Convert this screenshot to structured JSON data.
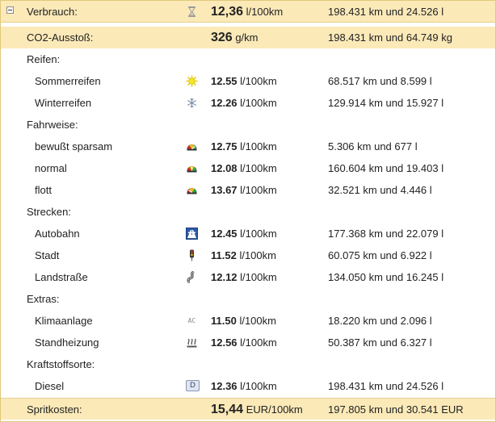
{
  "colors": {
    "highlight": "#fbe9b8",
    "border": "#e0c97a"
  },
  "summary": {
    "consumption": {
      "label": "Verbrauch:",
      "icon": "hourglass-icon",
      "value": "12,36",
      "unit": "l/100km",
      "detail": "198.431 km und 24.526 l"
    },
    "co2": {
      "label": "CO2-Ausstoß:",
      "value": "326",
      "unit": "g/km",
      "detail": "198.431 km und 64.749 kg"
    }
  },
  "groups": [
    {
      "label": "Reifen:",
      "items": [
        {
          "label": "Sommerreifen",
          "icon": "sun-icon",
          "value": "12.55",
          "unit": "l/100km",
          "detail": "68.517 km und 8.599 l"
        },
        {
          "label": "Winterreifen",
          "icon": "snowflake-icon",
          "value": "12.26",
          "unit": "l/100km",
          "detail": "129.914 km und 15.927 l"
        }
      ]
    },
    {
      "label": "Fahrweise:",
      "items": [
        {
          "label": "bewußt sparsam",
          "icon": "speedometer-green-icon",
          "value": "12.75",
          "unit": "l/100km",
          "detail": "5.306 km und 677 l"
        },
        {
          "label": "normal",
          "icon": "speedometer-yellow-icon",
          "value": "12.08",
          "unit": "l/100km",
          "detail": "160.604 km und 19.403 l"
        },
        {
          "label": "flott",
          "icon": "speedometer-red-icon",
          "value": "13.67",
          "unit": "l/100km",
          "detail": "32.521 km und 4.446 l"
        }
      ]
    },
    {
      "label": "Strecken:",
      "items": [
        {
          "label": "Autobahn",
          "icon": "autobahn-icon",
          "value": "12.45",
          "unit": "l/100km",
          "detail": "177.368 km und 22.079 l"
        },
        {
          "label": "Stadt",
          "icon": "traffic-light-icon",
          "value": "11.52",
          "unit": "l/100km",
          "detail": "60.075 km und 6.922 l"
        },
        {
          "label": "Landstraße",
          "icon": "winding-road-icon",
          "value": "12.12",
          "unit": "l/100km",
          "detail": "134.050 km und 16.245 l"
        }
      ]
    },
    {
      "label": "Extras:",
      "items": [
        {
          "label": "Klimaanlage",
          "icon": "ac-icon",
          "icon_text": "AC",
          "value": "11.50",
          "unit": "l/100km",
          "detail": "18.220 km und 2.096 l"
        },
        {
          "label": "Standheizung",
          "icon": "heater-icon",
          "value": "12.56",
          "unit": "l/100km",
          "detail": "50.387 km und 6.327 l"
        }
      ]
    },
    {
      "label": "Kraftstoffsorte:",
      "items": [
        {
          "label": "Diesel",
          "icon": "diesel-icon",
          "icon_text": "D",
          "value": "12.36",
          "unit": "l/100km",
          "detail": "198.431 km und 24.526 l"
        }
      ]
    }
  ],
  "costs": {
    "label": "Spritkosten:",
    "value": "15,44",
    "unit": "EUR/100km",
    "detail": "197.805 km und 30.541 EUR"
  }
}
